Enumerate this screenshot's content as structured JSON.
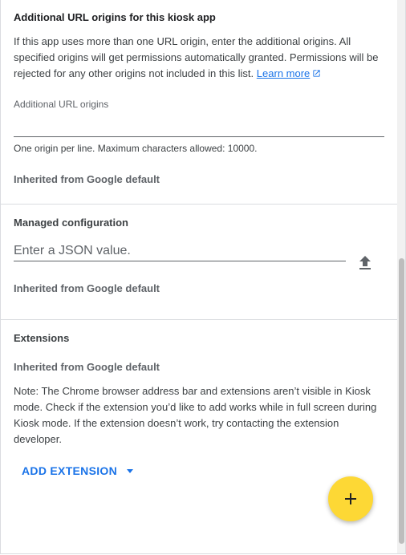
{
  "url_origins": {
    "title": "Additional URL origins for this kiosk app",
    "description": "If this app uses more than one URL origin, enter the additional origins. All specified origins will get permissions automatically granted. Permissions will be rejected for any other origins not included in this list.",
    "learn_more": "Learn more",
    "field_label": "Additional URL origins",
    "field_value": "",
    "hint": "One origin per line. Maximum characters allowed: 10000.",
    "inherited": "Inherited from Google default"
  },
  "managed_config": {
    "title": "Managed configuration",
    "placeholder": "Enter a JSON value.",
    "upload_icon": "upload-icon",
    "inherited": "Inherited from Google default"
  },
  "extensions": {
    "title": "Extensions",
    "inherited": "Inherited from Google default",
    "note": "Note: The Chrome browser address bar and extensions aren’t visible in Kiosk mode. Check if the extension you’d like to add works while in full screen during Kiosk mode. If the extension doesn’t work, try contacting the extension developer.",
    "add_button": "ADD EXTENSION"
  },
  "fab": {
    "icon": "plus-icon",
    "color": "#fdd835"
  },
  "colors": {
    "accent": "#1a73e8",
    "divider": "#dadce0"
  }
}
